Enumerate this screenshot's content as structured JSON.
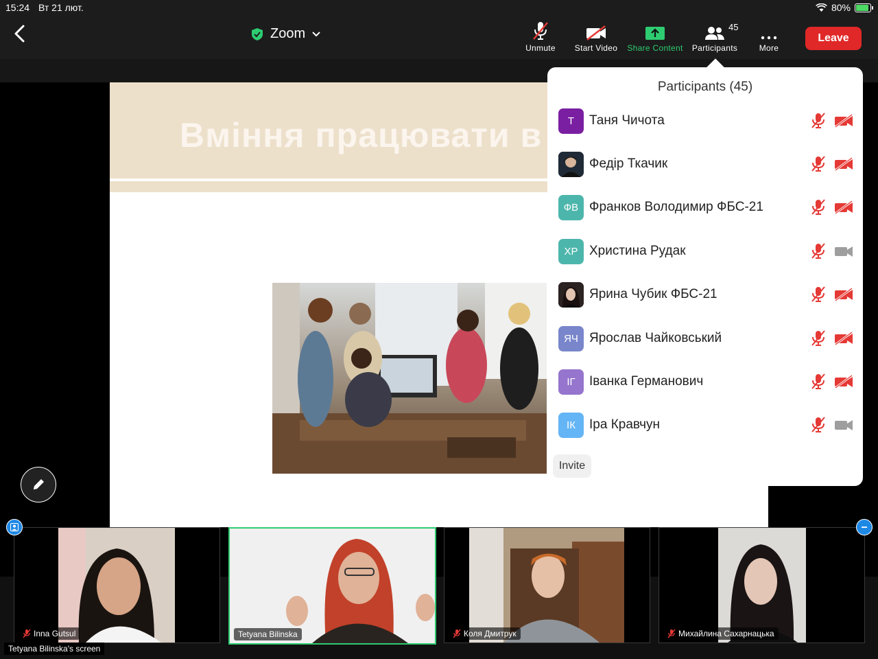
{
  "status_bar": {
    "time": "15:24",
    "date": "Вт 21 лют.",
    "battery": "80%"
  },
  "meeting": {
    "app_title": "Zoom"
  },
  "toolbar": {
    "unmute": "Unmute",
    "start_video": "Start Video",
    "share_content": "Share Content",
    "participants": "Participants",
    "participants_count": "45",
    "more": "More",
    "leave": "Leave"
  },
  "slide": {
    "title": "Вміння працювати в"
  },
  "participants_panel": {
    "title": "Participants (45)",
    "participants": [
      {
        "initials": "Т",
        "name": "Таня Чичота",
        "avatar_color": "#7b1fa2",
        "photo": false,
        "video": "off"
      },
      {
        "initials": "",
        "name": "Федір Ткачик",
        "avatar_color": "#2a3a4a",
        "photo": true,
        "video": "off"
      },
      {
        "initials": "ФВ",
        "name": "Франков Володимир ФБС-21",
        "avatar_color": "#4db6ac",
        "photo": false,
        "video": "off"
      },
      {
        "initials": "ХР",
        "name": "Христина Рудак",
        "avatar_color": "#4db6ac",
        "photo": false,
        "video": "on"
      },
      {
        "initials": "",
        "name": "Ярина Чубик ФБС-21",
        "avatar_color": "#3a2a2a",
        "photo": true,
        "video": "off"
      },
      {
        "initials": "ЯЧ",
        "name": "Ярослав Чайковський",
        "avatar_color": "#7986cb",
        "photo": false,
        "video": "off"
      },
      {
        "initials": "ІГ",
        "name": "Іванка Германович",
        "avatar_color": "#9575cd",
        "photo": false,
        "video": "off"
      },
      {
        "initials": "ІК",
        "name": "Іра Кравчун",
        "avatar_color": "#64b5f6",
        "photo": false,
        "video": "on"
      }
    ],
    "invite": "Invite"
  },
  "video_tiles": [
    {
      "name": "Inna Gutsul",
      "muted": true,
      "active": false
    },
    {
      "name": "Tetyana Bilinska",
      "muted": false,
      "active": true
    },
    {
      "name": "Коля Дмитрук",
      "muted": true,
      "active": false
    },
    {
      "name": "Михайлина Сахарнацька",
      "muted": true,
      "active": false
    }
  ],
  "screen_share": {
    "label": "Tetyana Bilinska's screen"
  },
  "colors": {
    "leave": "#e02828",
    "share": "#2ecc71",
    "muted": "#e53935",
    "accent": "#1e88e5"
  }
}
